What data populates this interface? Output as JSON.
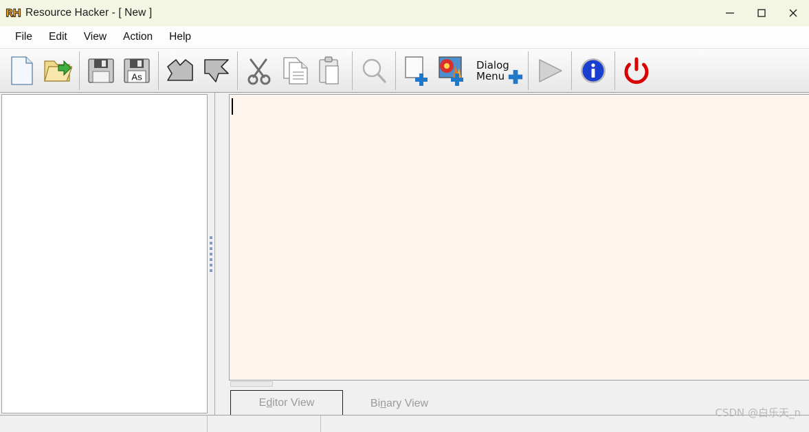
{
  "window": {
    "app_icon": "rh-logo-icon",
    "logo_text": "RH",
    "title": "Resource Hacker - [ New ]",
    "titlebar_color": "#f2f6e3",
    "controls": {
      "minimize": "minimize-icon",
      "maximize": "maximize-icon",
      "close": "close-icon"
    }
  },
  "menubar": {
    "items": [
      {
        "label": "File"
      },
      {
        "label": "Edit"
      },
      {
        "label": "View"
      },
      {
        "label": "Action"
      },
      {
        "label": "Help"
      }
    ]
  },
  "toolbar": {
    "buttons": [
      {
        "name": "new-file-button",
        "icon": "new-document-icon",
        "tooltip": "New"
      },
      {
        "name": "open-file-button",
        "icon": "open-folder-icon",
        "tooltip": "Open"
      },
      {
        "name": "save-button",
        "icon": "save-floppy-icon",
        "tooltip": "Save"
      },
      {
        "name": "save-as-button",
        "icon": "save-as-floppy-icon",
        "label": "As",
        "tooltip": "Save As"
      },
      {
        "name": "compile-script-button",
        "icon": "compile-arrow-icon",
        "tooltip": "Compile Script"
      },
      {
        "name": "disassemble-button",
        "icon": "disassemble-arrow-icon",
        "tooltip": "Disassemble"
      },
      {
        "name": "cut-button",
        "icon": "scissors-icon",
        "tooltip": "Cut"
      },
      {
        "name": "copy-button",
        "icon": "copy-pages-icon",
        "tooltip": "Copy"
      },
      {
        "name": "paste-button",
        "icon": "clipboard-paste-icon",
        "tooltip": "Paste"
      },
      {
        "name": "find-button",
        "icon": "magnifier-icon",
        "tooltip": "Find"
      },
      {
        "name": "add-resource-button",
        "icon": "page-plus-icon",
        "tooltip": "Add Resource"
      },
      {
        "name": "add-image-button",
        "icon": "image-plus-icon",
        "tooltip": "Add Image"
      },
      {
        "name": "add-dialog-menu-button",
        "icon": "dialog-menu-plus-icon",
        "label": "Dialog\nMenu",
        "tooltip": "Add Dialog or Menu"
      },
      {
        "name": "run-button",
        "icon": "play-triangle-icon",
        "tooltip": "Run",
        "disabled": true
      },
      {
        "name": "about-button",
        "icon": "info-circle-icon",
        "tooltip": "About"
      },
      {
        "name": "exit-button",
        "icon": "power-icon",
        "tooltip": "Exit"
      }
    ],
    "dialog_menu_line1": "Dialog",
    "dialog_menu_line2": "Menu"
  },
  "panes": {
    "resource_tree": {
      "name": "resource-tree-panel",
      "items": []
    },
    "splitter": {
      "name": "pane-splitter"
    },
    "editor": {
      "name": "editor-text-area",
      "value": "",
      "background": "#fdf5ee"
    }
  },
  "tabs": [
    {
      "label_before": "E",
      "accel": "d",
      "label_after": "itor View",
      "full": "Editor View",
      "active": true
    },
    {
      "label_before": "Bi",
      "accel": "n",
      "label_after": "ary View",
      "full": "Binary View",
      "active": false
    }
  ],
  "statusbar": {
    "cells": [
      "",
      "",
      ""
    ]
  },
  "watermark": "CSDN @白乐天_n"
}
